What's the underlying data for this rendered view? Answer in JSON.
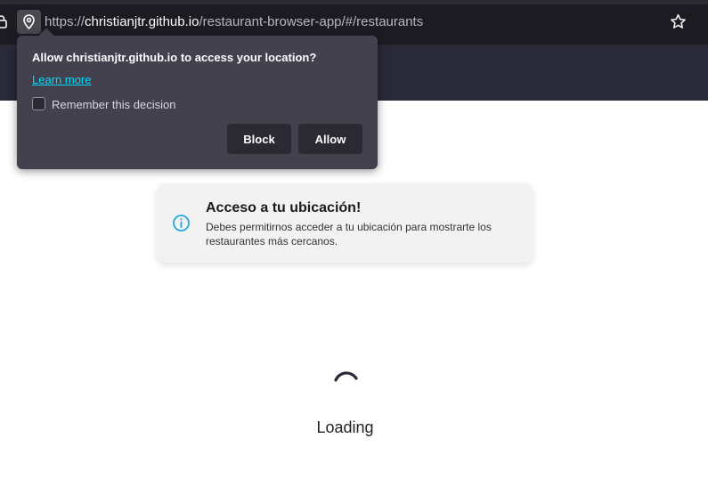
{
  "browser": {
    "url_prefix": "https://",
    "url_domain": "christianjtr.github.io",
    "url_path": "/restaurant-browser-app/#/restaurants"
  },
  "permission_popup": {
    "title": "Allow christianjtr.github.io to access your location?",
    "learn_more": "Learn more",
    "remember_label": "Remember this decision",
    "remember_checked": false,
    "block_label": "Block",
    "allow_label": "Allow"
  },
  "info_card": {
    "title": "Acceso a tu ubicación!",
    "body": "Debes permitirnos acceder a tu ubicación para mostrarte los restaurantes más cercanos.",
    "accent_color": "#1fa9e0"
  },
  "loading": {
    "text": "Loading"
  }
}
